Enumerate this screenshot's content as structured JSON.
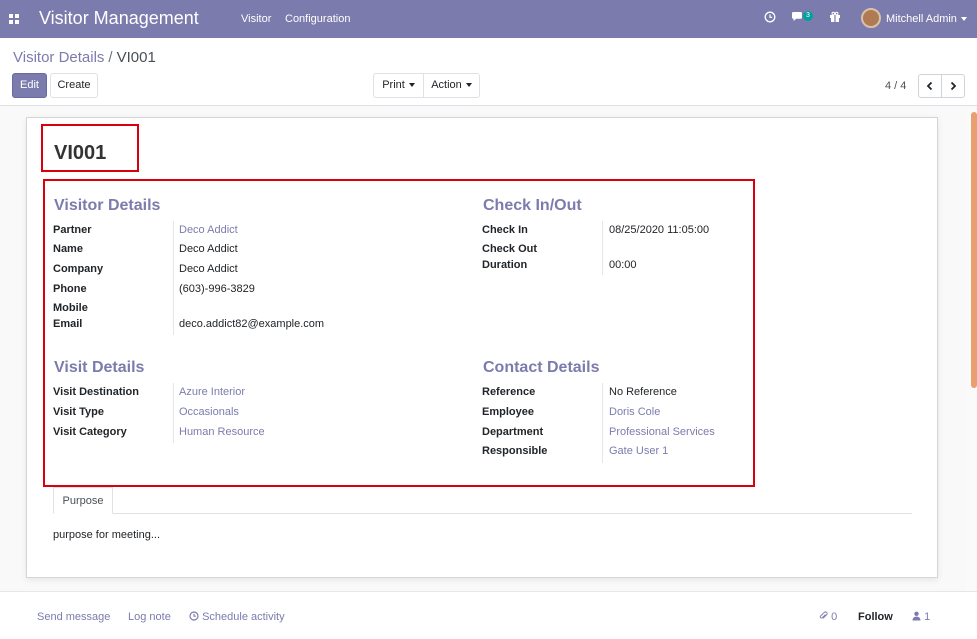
{
  "navbar": {
    "brand": "Visitor Management",
    "menu": [
      {
        "label": "Visitor"
      },
      {
        "label": "Configuration"
      }
    ],
    "chat_count": "3",
    "user_name": "Mitchell Admin",
    "icons": [
      "apps-icon",
      "clock-icon",
      "chat-icon",
      "gift-icon",
      "avatar",
      "chevron-down-icon"
    ]
  },
  "breadcrumb": {
    "parent": "Visitor Details",
    "separator": "/",
    "current": "VI001"
  },
  "buttons": {
    "edit": "Edit",
    "create": "Create",
    "print": "Print",
    "action": "Action"
  },
  "pager": {
    "value": "4 / 4",
    "prev": "‹",
    "next": "›"
  },
  "record": {
    "title": "VI001"
  },
  "visitor_details": {
    "title": "Visitor Details",
    "fields": [
      {
        "label": "Partner",
        "value": "Deco Addict"
      },
      {
        "label": "Name",
        "value": "Deco Addict"
      },
      {
        "label": "Company",
        "value": "Deco Addict"
      },
      {
        "label": "Phone",
        "value": "(603)-996-3829"
      },
      {
        "label": "Mobile",
        "value": ""
      },
      {
        "label": "Email",
        "value": "deco.addict82@example.com"
      }
    ]
  },
  "check_in_out": {
    "title": "Check In/Out",
    "fields": [
      {
        "label": "Check In",
        "value": "08/25/2020 11:05:00"
      },
      {
        "label": "Check Out",
        "value": ""
      },
      {
        "label": "Duration",
        "value": "00:00"
      }
    ]
  },
  "visit_details": {
    "title": "Visit Details",
    "fields": [
      {
        "label": "Visit Destination",
        "value": "Azure Interior"
      },
      {
        "label": "Visit Type",
        "value": "Occasionals"
      },
      {
        "label": "Visit Category",
        "value": "Human Resource"
      }
    ]
  },
  "contact_details": {
    "title": "Contact Details",
    "fields": [
      {
        "label": "Reference",
        "value": "No Reference"
      },
      {
        "label": "Employee",
        "value": "Doris Cole"
      },
      {
        "label": "Department",
        "value": "Professional Services"
      },
      {
        "label": "Responsible",
        "value": "Gate User 1"
      }
    ]
  },
  "notebook": {
    "tab": "Purpose",
    "content": "purpose for meeting..."
  },
  "chatter": {
    "send_message": "Send message",
    "log_note": "Log note",
    "schedule_activity": "Schedule activity",
    "attachments": "0",
    "follow": "Follow",
    "followers": "1"
  },
  "colors": {
    "accent": "#7c7bad",
    "highlight": "#d9000e"
  }
}
